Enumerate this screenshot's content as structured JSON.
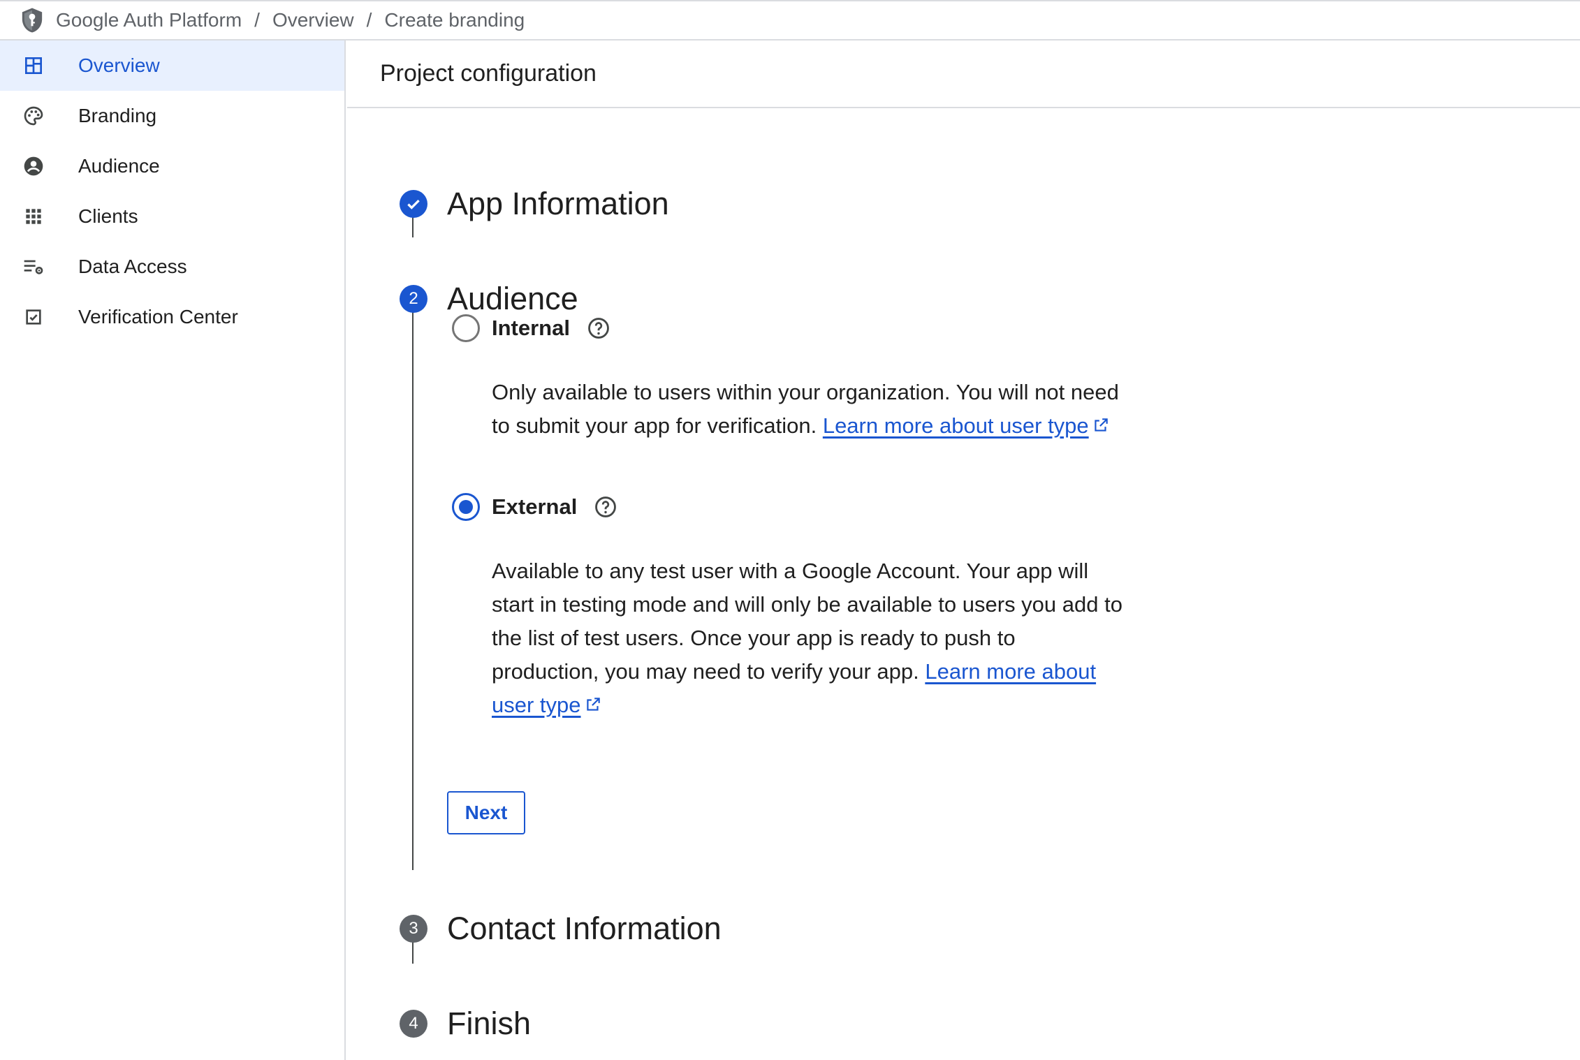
{
  "breadcrumb": {
    "items": [
      "Google Auth Platform",
      "Overview",
      "Create branding"
    ],
    "separator": "/"
  },
  "sidebar": {
    "items": [
      {
        "label": "Overview",
        "icon": "dashboard-icon",
        "active": true
      },
      {
        "label": "Branding",
        "icon": "palette-icon",
        "active": false
      },
      {
        "label": "Audience",
        "icon": "account-circle-icon",
        "active": false
      },
      {
        "label": "Clients",
        "icon": "grid-icon",
        "active": false
      },
      {
        "label": "Data Access",
        "icon": "list-settings-icon",
        "active": false
      },
      {
        "label": "Verification Center",
        "icon": "checkbox-icon",
        "active": false
      }
    ]
  },
  "main": {
    "title": "Project configuration",
    "steps": [
      {
        "number": "1",
        "title": "App Information",
        "status": "complete"
      },
      {
        "number": "2",
        "title": "Audience",
        "status": "active"
      },
      {
        "number": "3",
        "title": "Contact Information",
        "status": "pending"
      },
      {
        "number": "4",
        "title": "Finish",
        "status": "pending"
      }
    ],
    "audience": {
      "internal": {
        "label": "Internal",
        "selected": false,
        "description": "Only available to users within your organization. You will not need to submit your app for verification. ",
        "link_text": "Learn more about user type"
      },
      "external": {
        "label": "External",
        "selected": true,
        "description": "Available to any test user with a Google Account. Your app will start in testing mode and will only be available to users you add to the list of test users. Once your app is ready to push to production, you may need to verify your app. ",
        "link_text": "Learn more about user type"
      }
    },
    "next_label": "Next"
  },
  "colors": {
    "accent": "#1a56d0",
    "active_nav_bg": "#e8f0fe",
    "pending_badge": "#5f6368",
    "divider": "#dadce0"
  }
}
